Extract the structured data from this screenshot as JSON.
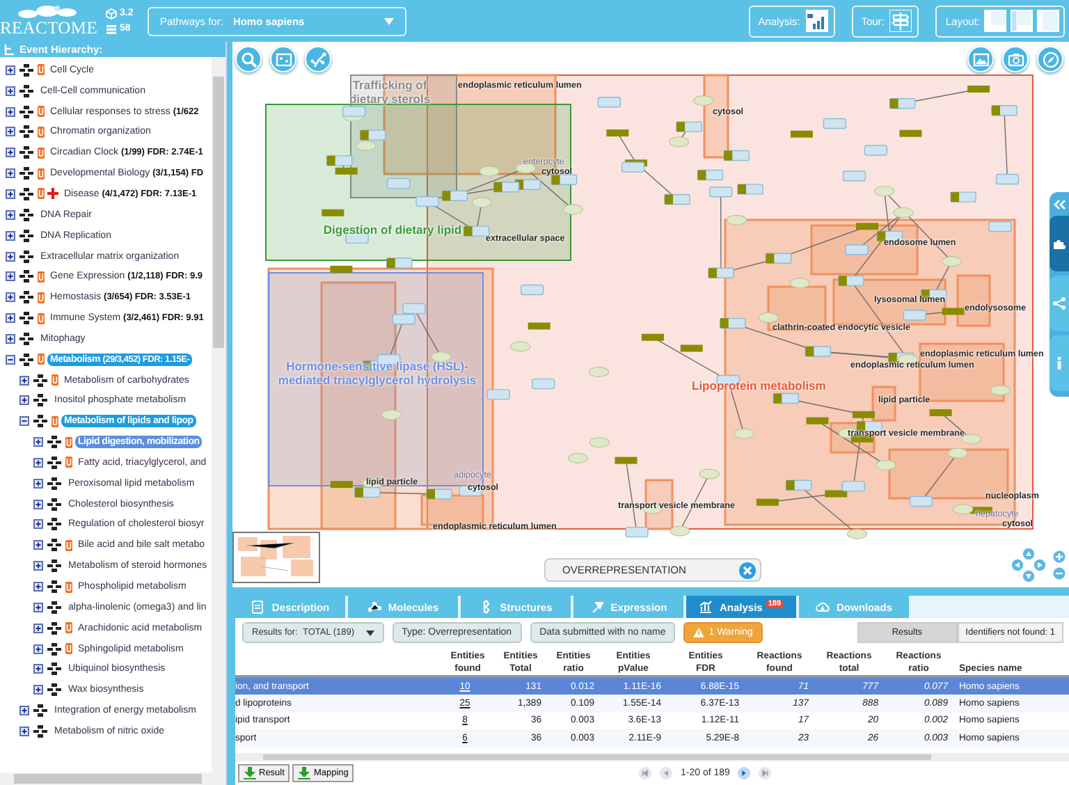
{
  "header": {
    "logo": "REACTOME",
    "version": "3.2",
    "db_version": "58",
    "species_label": "Pathways for:",
    "species": "Homo sapiens",
    "analysis_label": "Analysis:",
    "tour_label": "Tour:",
    "layout_label": "Layout:"
  },
  "hierarchy": {
    "title": "Event Hierarchy:",
    "items": [
      {
        "label": "Cell Cycle",
        "flagged": true,
        "cross": false,
        "expanded": false,
        "selected": false,
        "highlighted": false
      },
      {
        "label": "Cell-Cell communication",
        "flagged": false,
        "cross": false,
        "expanded": false,
        "selected": false,
        "highlighted": false
      },
      {
        "label": "Cellular responses to stress",
        "stats": "(1/622",
        "flagged": true,
        "cross": false,
        "expanded": false,
        "selected": false,
        "highlighted": false
      },
      {
        "label": "Chromatin organization",
        "flagged": true,
        "cross": false,
        "expanded": false,
        "selected": false,
        "highlighted": false
      },
      {
        "label": "Circadian Clock",
        "stats": "(1/99) FDR: 2.74E-1",
        "flagged": true,
        "cross": false,
        "expanded": false,
        "selected": false,
        "highlighted": false
      },
      {
        "label": "Developmental Biology",
        "stats": "(3/1,154) FD",
        "flagged": true,
        "cross": false,
        "expanded": false,
        "selected": false,
        "highlighted": false
      },
      {
        "label": "Disease",
        "stats": "(4/1,472) FDR: 7.13E-1",
        "flagged": true,
        "cross": true,
        "expanded": false,
        "selected": false,
        "highlighted": false
      },
      {
        "label": "DNA Repair",
        "flagged": false,
        "cross": false,
        "expanded": false,
        "selected": false,
        "highlighted": false
      },
      {
        "label": "DNA Replication",
        "flagged": false,
        "cross": false,
        "expanded": false,
        "selected": false,
        "highlighted": false
      },
      {
        "label": "Extracellular matrix organization",
        "flagged": false,
        "cross": false,
        "expanded": false,
        "selected": false,
        "highlighted": false
      },
      {
        "label": "Gene Expression",
        "stats": "(1/2,118) FDR: 9.9",
        "flagged": true,
        "cross": false,
        "expanded": false,
        "selected": false,
        "highlighted": false
      },
      {
        "label": "Hemostasis",
        "stats": "(3/654) FDR: 3.53E-1",
        "flagged": true,
        "cross": false,
        "expanded": false,
        "selected": false,
        "highlighted": false
      },
      {
        "label": "Immune System",
        "stats": "(3/2,461) FDR: 9.91",
        "flagged": true,
        "cross": false,
        "expanded": false,
        "selected": false,
        "highlighted": false
      },
      {
        "label": "Mitophagy",
        "flagged": false,
        "cross": false,
        "expanded": false,
        "selected": false,
        "highlighted": false
      },
      {
        "label": "Metabolism",
        "stats": "(29/3,452) FDR: 1.15E-",
        "flagged": true,
        "cross": false,
        "expanded": true,
        "selected": false,
        "highlighted": true,
        "children": [
          {
            "label": "Metabolism of carbohydrates",
            "flagged": true,
            "cross": false,
            "expanded": false,
            "selected": false,
            "highlighted": false
          },
          {
            "label": "Inositol phosphate metabolism",
            "flagged": false,
            "cross": false,
            "expanded": false,
            "selected": false,
            "highlighted": false
          },
          {
            "label": "Metabolism of lipids and lipop",
            "flagged": true,
            "cross": false,
            "expanded": true,
            "selected": false,
            "highlighted": true,
            "children": [
              {
                "label": "Lipid digestion, mobilization",
                "flagged": true,
                "cross": false,
                "expanded": false,
                "selected": true,
                "highlighted": false
              },
              {
                "label": "Fatty acid, triacylglycerol, and",
                "flagged": true,
                "cross": false,
                "expanded": false,
                "selected": false,
                "highlighted": false
              },
              {
                "label": "Peroxisomal lipid metabolism",
                "flagged": false,
                "cross": false,
                "expanded": false,
                "selected": false,
                "highlighted": false
              },
              {
                "label": "Cholesterol biosynthesis",
                "flagged": false,
                "cross": false,
                "expanded": false,
                "selected": false,
                "highlighted": false
              },
              {
                "label": "Regulation of cholesterol biosyr",
                "flagged": false,
                "cross": false,
                "expanded": false,
                "selected": false,
                "highlighted": false
              },
              {
                "label": "Bile acid and bile salt metabo",
                "flagged": true,
                "cross": false,
                "expanded": false,
                "selected": false,
                "highlighted": false
              },
              {
                "label": "Metabolism of steroid hormones",
                "flagged": false,
                "cross": false,
                "expanded": false,
                "selected": false,
                "highlighted": false
              },
              {
                "label": "Phospholipid metabolism",
                "flagged": true,
                "cross": false,
                "expanded": false,
                "selected": false,
                "highlighted": false
              },
              {
                "label": "alpha-linolenic (omega3) and lin",
                "flagged": false,
                "cross": false,
                "expanded": false,
                "selected": false,
                "highlighted": false
              },
              {
                "label": "Arachidonic acid metabolism",
                "flagged": true,
                "cross": false,
                "expanded": false,
                "selected": false,
                "highlighted": false
              },
              {
                "label": "Sphingolipid metabolism",
                "flagged": true,
                "cross": false,
                "expanded": false,
                "selected": false,
                "highlighted": false
              },
              {
                "label": "Ubiquinol biosynthesis",
                "flagged": false,
                "cross": false,
                "expanded": false,
                "selected": false,
                "highlighted": false
              },
              {
                "label": "Wax biosynthesis",
                "flagged": false,
                "cross": false,
                "expanded": false,
                "selected": false,
                "highlighted": false
              }
            ]
          },
          {
            "label": "Integration of energy metabolism",
            "flagged": false,
            "cross": false,
            "expanded": false,
            "selected": false,
            "highlighted": false
          },
          {
            "label": "Metabolism of nitric oxide",
            "flagged": false,
            "cross": false,
            "expanded": false,
            "selected": false,
            "highlighted": false
          }
        ]
      }
    ]
  },
  "diagram": {
    "subpathways": [
      {
        "label": "Trafficking of dietary sterols",
        "color": "#8c8c8c"
      },
      {
        "label": "Digestion of dietary lipid",
        "color": "#3a9a3a"
      },
      {
        "label": "Hormone-sensitive lipase (HSL)-mediated triacylglycerol hydrolysis",
        "color": "#6f8fe0"
      },
      {
        "label": "Lipoprotein metabolism",
        "color": "#e8583a"
      }
    ],
    "labels": [
      {
        "text": "endoplasmic reticulum lumen",
        "kind": "compartment"
      },
      {
        "text": "cytosol",
        "kind": "compartment"
      },
      {
        "text": "enterocyte",
        "kind": "cell"
      },
      {
        "text": "cytosol",
        "kind": "compartment"
      },
      {
        "text": "extracellular space",
        "kind": "compartment"
      },
      {
        "text": "lipid particle",
        "kind": "compartment"
      },
      {
        "text": "adipocyte",
        "kind": "cell"
      },
      {
        "text": "cytosol",
        "kind": "compartment"
      },
      {
        "text": "endoplasmic reticulum lumen",
        "kind": "compartment"
      },
      {
        "text": "endosome lumen",
        "kind": "compartment"
      },
      {
        "text": "lysosomal lumen",
        "kind": "compartment"
      },
      {
        "text": "endolysosome",
        "kind": "compartment"
      },
      {
        "text": "clathrin-coated endocytic vesicle",
        "kind": "compartment"
      },
      {
        "text": "endoplasmic reticulum lumen",
        "kind": "compartment"
      },
      {
        "text": "endoplasmic reticulum lumen",
        "kind": "compartment"
      },
      {
        "text": "lipid particle",
        "kind": "compartment"
      },
      {
        "text": "transport vesicle membrane",
        "kind": "compartment"
      },
      {
        "text": "nucleoplasm",
        "kind": "compartment"
      },
      {
        "text": "hepatocyte",
        "kind": "cell"
      },
      {
        "text": "cytosol",
        "kind": "compartment"
      },
      {
        "text": "transport vesicle membrane",
        "kind": "compartment"
      }
    ],
    "overlay": "OVERREPRESENTATION"
  },
  "details": {
    "tabs": [
      {
        "label": "Description",
        "selected": false
      },
      {
        "label": "Molecules",
        "selected": false
      },
      {
        "label": "Structures",
        "selected": false
      },
      {
        "label": "Expression",
        "selected": false
      },
      {
        "label": "Analysis",
        "selected": true,
        "badge": "189"
      },
      {
        "label": "Downloads",
        "selected": false
      }
    ],
    "results_for_label": "Results for:",
    "results_for": "TOTAL (189)",
    "type": "Type: Overrepresentation",
    "data_name": "Data submitted with no name",
    "warning": "1 Warning",
    "views": [
      {
        "label": "Results",
        "selected": true
      },
      {
        "label": "Identifiers not found: 1",
        "selected": false
      }
    ],
    "table": {
      "columns": [
        "Entities found",
        "Entities Total",
        "Entities ratio",
        "Entities pValue",
        "Entities FDR",
        "Reactions found",
        "Reactions total",
        "Reactions ratio",
        "Species name"
      ],
      "rows": [
        {
          "name": "ion, and transport",
          "values": [
            "10",
            "131",
            "0.012",
            "1.11E-16",
            "6.88E-15",
            "71",
            "777",
            "0.077",
            "Homo sapiens"
          ],
          "selected": true
        },
        {
          "name": "d lipoproteins",
          "values": [
            "25",
            "1,389",
            "0.109",
            "1.55E-14",
            "6.37E-13",
            "137",
            "888",
            "0.089",
            "Homo sapiens"
          ],
          "selected": false
        },
        {
          "name": "ipid transport",
          "values": [
            "8",
            "36",
            "0.003",
            "3.6E-13",
            "1.12E-11",
            "17",
            "20",
            "0.002",
            "Homo sapiens"
          ],
          "selected": false
        },
        {
          "name": "sport",
          "values": [
            "6",
            "36",
            "0.003",
            "2.11E-9",
            "5.29E-8",
            "23",
            "26",
            "0.003",
            "Homo sapiens"
          ],
          "selected": false
        }
      ]
    },
    "buttons": [
      "Result",
      "Mapping"
    ],
    "pagination": "1-20 of 189"
  }
}
